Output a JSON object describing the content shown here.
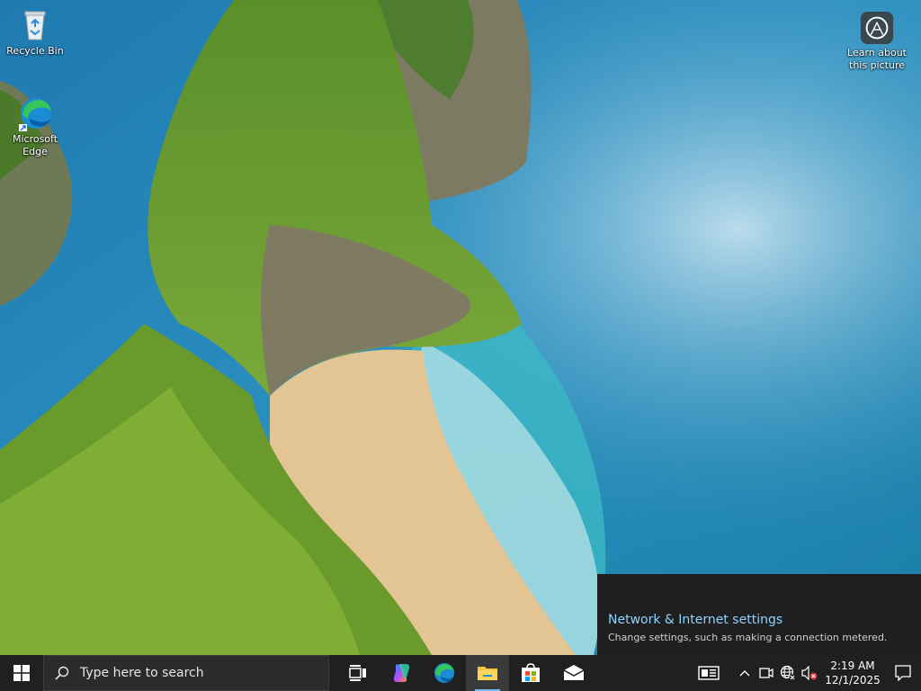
{
  "desktop": {
    "icons": [
      {
        "label": "Recycle Bin",
        "icon": "recycle-bin-icon"
      },
      {
        "label": "Microsoft Edge",
        "icon": "edge-icon"
      }
    ],
    "learn_about": {
      "label": "Learn about this picture",
      "icon": "camera-icon"
    }
  },
  "flyout": {
    "title": "Network & Internet settings",
    "description": "Change settings, such as making a connection metered."
  },
  "taskbar": {
    "search_placeholder": "Type here to search",
    "pinned": [
      {
        "name": "task-view",
        "icon": "task-view-icon"
      },
      {
        "name": "copilot",
        "icon": "copilot-icon"
      },
      {
        "name": "edge",
        "icon": "edge-icon"
      },
      {
        "name": "file-explorer",
        "icon": "folder-icon"
      },
      {
        "name": "store",
        "icon": "store-icon"
      },
      {
        "name": "mail",
        "icon": "mail-icon"
      }
    ],
    "clock": {
      "time": "2:19 AM",
      "date": "12/1/2025"
    }
  },
  "colors": {
    "taskbar_bg": "#202020",
    "flyout_bg": "#1f1f1f",
    "link_blue": "#8fd3ff",
    "accent": "#76b9ed"
  }
}
